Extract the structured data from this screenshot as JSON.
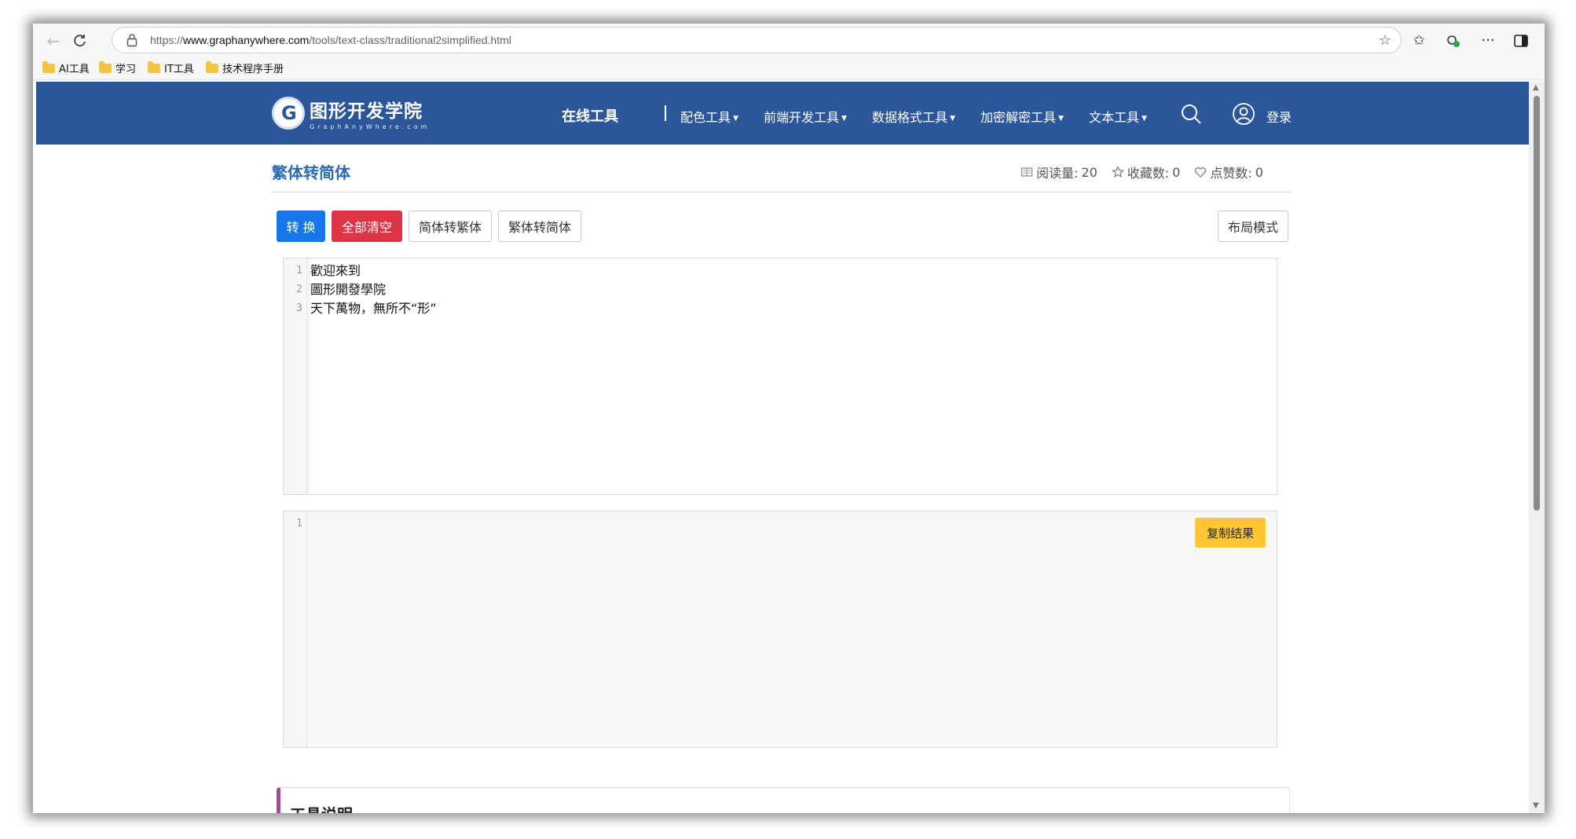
{
  "browser": {
    "url_prefix": "https://",
    "url_domain": "www.graphanywhere.com",
    "url_path": "/tools/text-class/traditional2simplified.html",
    "bookmarks": [
      "AI工具",
      "学习",
      "IT工具",
      "技术程序手册"
    ]
  },
  "site": {
    "logo_cn": "图形开发学院",
    "logo_en": "GraphAnyWhere.com",
    "nav_main": "在线工具",
    "nav_items": [
      "配色工具",
      "前端开发工具",
      "数据格式工具",
      "加密解密工具",
      "文本工具"
    ],
    "login": "登录"
  },
  "tool": {
    "title": "繁体转简体",
    "stats": {
      "read_label": "阅读量:",
      "read_value": "20",
      "fav_label": "收藏数:",
      "fav_value": "0",
      "like_label": "点赞数:",
      "like_value": "0"
    },
    "buttons": {
      "convert": "转 换",
      "clear_all": "全部清空",
      "s2t": "简体转繁体",
      "t2s": "繁体转简体",
      "layout": "布局模式",
      "copy_result": "复制结果"
    },
    "input": {
      "line_numbers": [
        "1",
        "2",
        "3"
      ],
      "lines": [
        "歡迎來到",
        "圖形開發學院",
        "天下萬物，無所不“形”"
      ]
    },
    "output": {
      "line_numbers": [
        "1"
      ],
      "lines": [
        ""
      ]
    },
    "description_title": "工具说明"
  },
  "colors": {
    "header": "#2b579a",
    "primary": "#1677e8",
    "danger": "#dc3545",
    "warning": "#ffc832",
    "title": "#2b6cb0",
    "desc_accent": "#9b4f97"
  }
}
